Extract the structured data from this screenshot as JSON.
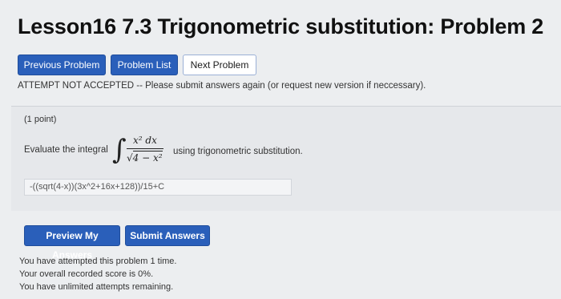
{
  "page": {
    "title": "Lesson16 7.3 Trigonometric substitution: Problem 2"
  },
  "nav": {
    "previous_label": "Previous Problem",
    "list_label": "Problem List",
    "next_label": "Next Problem"
  },
  "warning_text": "ATTEMPT NOT ACCEPTED -- Please submit answers again (or request new version if neccessary).",
  "problem": {
    "points": "(1 point)",
    "prompt": "Evaluate the integral",
    "integral_numerator": "x² dx",
    "integral_denominator_inner": "4 − x²",
    "method_text": "using trigonometric substitution.",
    "answer_value": "-((sqrt(4-x))(3x^2+16x+128))/15+C"
  },
  "actions": {
    "preview_label": "Preview My Answers",
    "submit_label": "Submit Answers"
  },
  "status": {
    "attempts": "You have attempted this problem 1 time.",
    "score": "Your overall recorded score is 0%.",
    "remaining": "You have unlimited attempts remaining."
  }
}
